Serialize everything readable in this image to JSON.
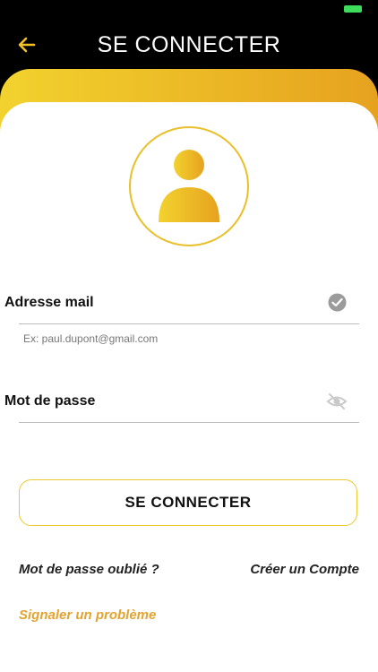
{
  "header": {
    "title": "SE CONNECTER"
  },
  "form": {
    "email_label": "Adresse mail",
    "email_hint": "Ex: paul.dupont@gmail.com",
    "password_label": "Mot de passe"
  },
  "actions": {
    "login_label": "SE CONNECTER",
    "forgot_password": "Mot de passe oublié ?",
    "create_account": "Créer un Compte",
    "report_problem": "Signaler un problème"
  },
  "colors": {
    "accent_gold": "#e9bf2a",
    "accent_orange": "#e3a330",
    "battery": "#3ddc5b"
  },
  "icons": {
    "back": "back-arrow-icon",
    "avatar": "user-avatar-icon",
    "email_valid": "checkmark-circle-icon",
    "password_visibility": "eye-off-icon"
  }
}
